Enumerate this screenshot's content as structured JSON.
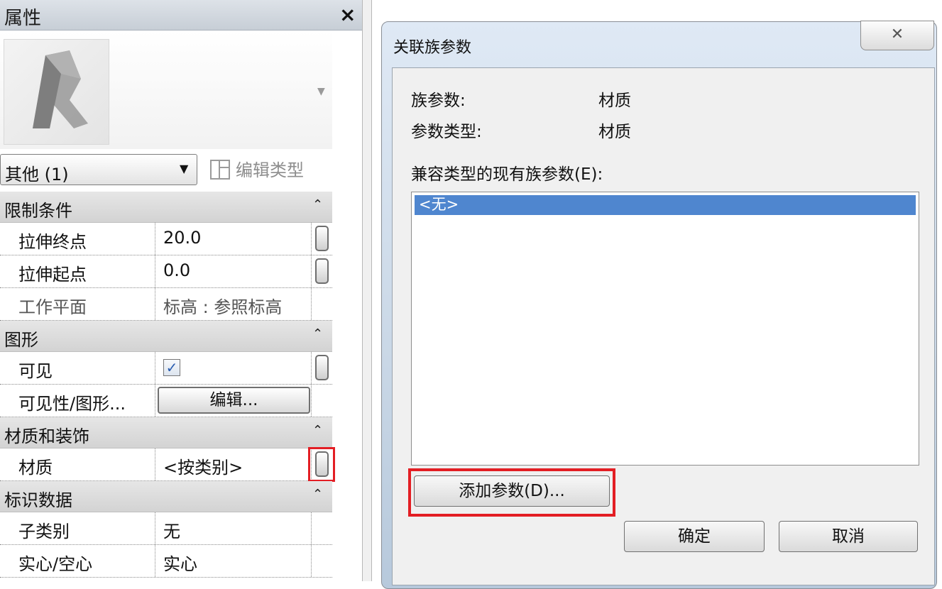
{
  "properties": {
    "title": "属性",
    "close_glyph": "×",
    "type_selector": {
      "value": "其他 (1)",
      "arrow": "▼"
    },
    "edit_type_label": "编辑类型",
    "groups": [
      {
        "name": "限制条件",
        "collapse_glyph": "ˆ",
        "rows": [
          {
            "key": "拉伸终点",
            "value": "20.0"
          },
          {
            "key": "拉伸起点",
            "value": "0.0"
          },
          {
            "key": "工作平面",
            "value": "标高 : 参照标高"
          }
        ]
      },
      {
        "name": "图形",
        "collapse_glyph": "ˆ",
        "rows": [
          {
            "key": "可见",
            "checked": "✓"
          },
          {
            "key": "可见性/图形...",
            "button": "编辑..."
          }
        ]
      },
      {
        "name": "材质和装饰",
        "collapse_glyph": "ˆ",
        "rows": [
          {
            "key": "材质",
            "value": "<按类别>"
          }
        ]
      },
      {
        "name": "标识数据",
        "collapse_glyph": "ˆ",
        "rows": [
          {
            "key": "子类别",
            "value": "无"
          },
          {
            "key": "实心/空心",
            "value": "实心"
          }
        ]
      }
    ]
  },
  "dialog": {
    "title": "关联族参数",
    "close_glyph": "✕",
    "family_param_label": "族参数:",
    "family_param_value": "材质",
    "param_type_label": "参数类型:",
    "param_type_value": "材质",
    "compatible_label": "兼容类型的现有族参数(E):",
    "list_items": [
      "<无>"
    ],
    "add_param_button": "添加参数(D)...",
    "ok_button": "确定",
    "cancel_button": "取消"
  },
  "colors": {
    "highlight": "#e31e24",
    "selection": "#4f86cf"
  }
}
